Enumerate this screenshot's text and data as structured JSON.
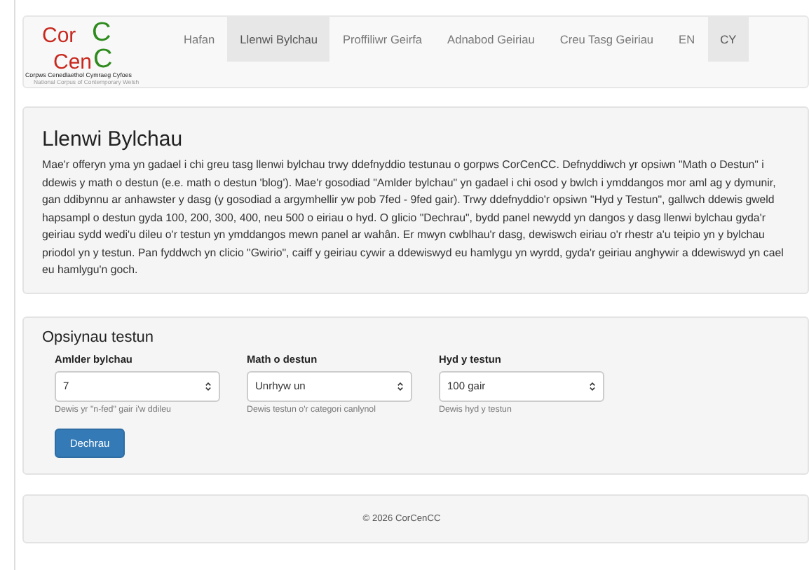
{
  "logo": {
    "parts": [
      {
        "text": "Cor",
        "color": "#c8281e"
      },
      {
        "text": "C",
        "color": "#2e8b1e"
      },
      {
        "text": "Cen",
        "color": "#c8281e"
      },
      {
        "text": "C",
        "color": "#2e8b1e"
      }
    ],
    "title": "Corpws Cenedlaethol Cymraeg Cyfoes",
    "subtitle": "National Corpus of Contemporary Welsh"
  },
  "nav": [
    {
      "label": "Hafan",
      "selected": false
    },
    {
      "label": "Llenwi Bylchau",
      "selected": true
    },
    {
      "label": "Proffiliwr Geirfa",
      "selected": false
    },
    {
      "label": "Adnabod Geiriau",
      "selected": false
    },
    {
      "label": "Creu Tasg Geiriau",
      "selected": false
    },
    {
      "label": "EN",
      "selected": false
    },
    {
      "label": "CY",
      "selected": true
    }
  ],
  "intro": {
    "heading": "Llenwi Bylchau",
    "text": "Mae'r offeryn yma yn gadael i chi greu tasg llenwi bylchau trwy ddefnyddio testunau o gorpws CorCenCC. Defnyddiwch yr opsiwn \"Math o Destun\" i ddewis y math o destun (e.e. math o destun 'blog'). Mae'r gosodiad \"Amlder bylchau\" yn gadael i chi osod y bwlch i ymddangos mor aml ag y dymunir, gan ddibynnu ar anhawster y dasg (y gosodiad a argymhellir yw pob 7fed - 9fed gair). Trwy ddefnyddio'r opsiwn \"Hyd y Testun\", gallwch ddewis gweld hapsampl o destun gyda 100, 200, 300, 400, neu 500 o eiriau o hyd. O glicio \"Dechrau\", bydd panel newydd yn dangos y dasg llenwi bylchau gyda'r geiriau sydd wedi'u dileu o'r testun yn ymddangos mewn panel ar wahân. Er mwyn cwblhau'r dasg, dewiswch eiriau o'r rhestr a'u teipio yn y bylchau priodol yn y testun. Pan fyddwch yn clicio \"Gwirio\", caiff y geiriau cywir a ddewiswyd eu hamlygu yn wyrdd, gyda'r geiriau anghywir a ddewiswyd yn cael eu hamlygu'n goch."
  },
  "options": {
    "heading": "Opsiynau testun",
    "fields": [
      {
        "label": "Amlder bylchau",
        "value": "7",
        "help": "Dewis yr \"n-fed\" gair i'w ddileu"
      },
      {
        "label": "Math o destun",
        "value": "Unrhyw un",
        "help": "Dewis testun o'r categori canlynol"
      },
      {
        "label": "Hyd y testun",
        "value": "100 gair",
        "help": "Dewis hyd y testun"
      }
    ],
    "button": "Dechrau"
  },
  "footer": "© 2026 CorCenCC"
}
